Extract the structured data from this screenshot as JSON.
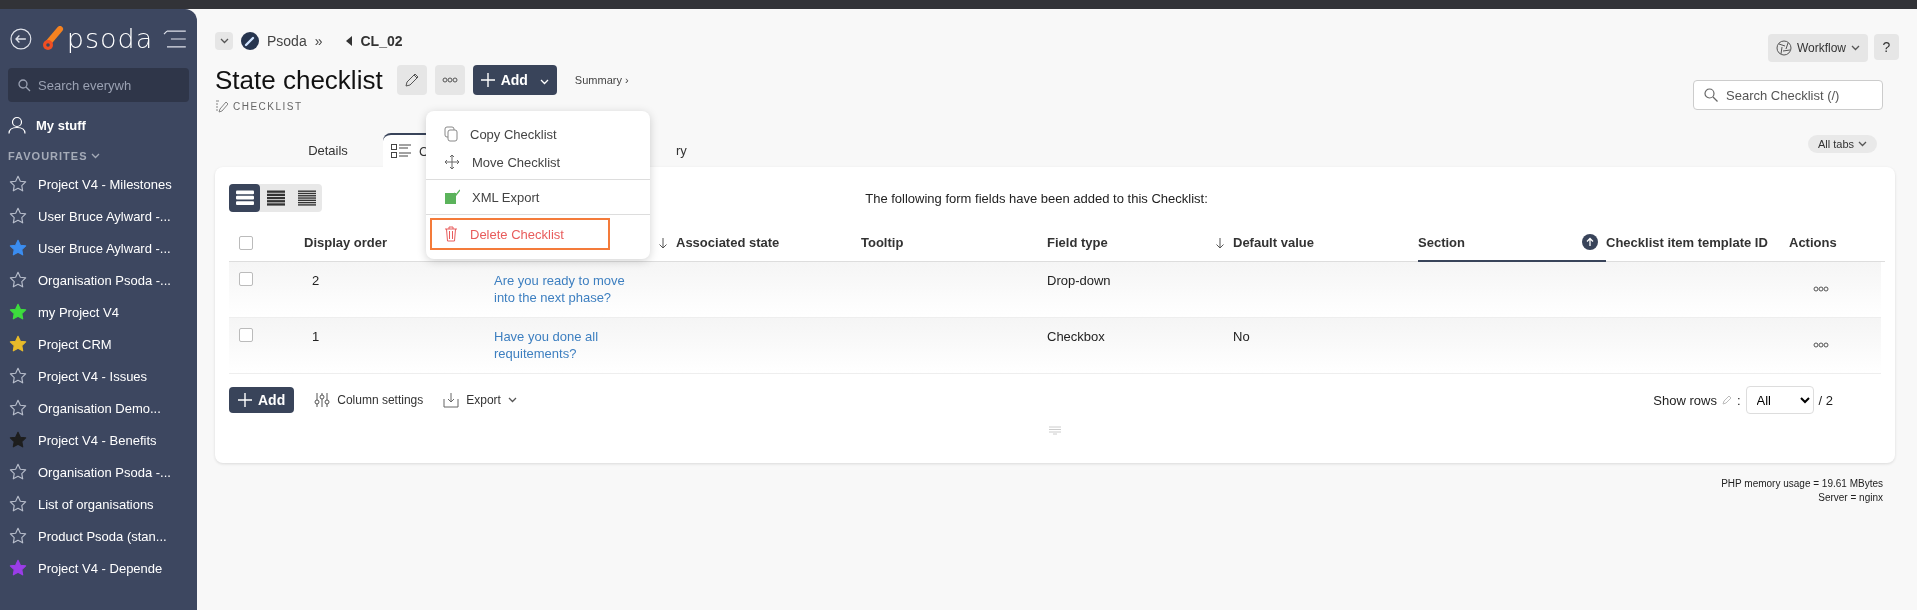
{
  "sidebar": {
    "logo": "psoda",
    "search": {
      "placeholder": "Search everywh"
    },
    "my_stuff": "My stuff",
    "favourites_heading": "FAVOURITES",
    "favourites": [
      {
        "label": "Project V4 - Milestones"
      },
      {
        "label": "User Bruce Aylward -..."
      },
      {
        "label": "User Bruce Aylward -...",
        "color": "#3b8df0"
      },
      {
        "label": "Organisation Psoda -..."
      },
      {
        "label": "my Project V4",
        "color": "#3ddc3d"
      },
      {
        "label": "Project CRM",
        "color": "#e8bb2a"
      },
      {
        "label": "Project V4 - Issues"
      },
      {
        "label": "Organisation Demo..."
      },
      {
        "label": "Project V4 - Benefits",
        "color": "#1e1e1e"
      },
      {
        "label": "Organisation Psoda -..."
      },
      {
        "label": "List of organisations"
      },
      {
        "label": "Product Psoda (stan..."
      },
      {
        "label": "Project V4 - Depende",
        "color": "#9b3de8"
      }
    ]
  },
  "breadcrumb": {
    "root": "Psoda",
    "separator": "»",
    "current": "CL_02"
  },
  "header": {
    "title": "State checklist",
    "add_button": "Add",
    "summary_link": "Summary ›",
    "type_label": "CHECKLIST",
    "workflow_button": "Workflow",
    "help_button": "?",
    "search": {
      "placeholder": "Search Checklist (/)"
    }
  },
  "tabs": [
    {
      "label": "Details",
      "selected": false
    },
    {
      "label": "C",
      "selected": true
    },
    {
      "label": "ry",
      "selected": false
    }
  ],
  "all_tabs_button": "All tabs",
  "menu": {
    "groups": [
      [
        {
          "label": "Copy Checklist",
          "kind": "copy",
          "highlighted": false
        },
        {
          "label": "Move Checklist",
          "kind": "move",
          "highlighted": false
        }
      ],
      [
        {
          "label": "XML Export",
          "kind": "xml",
          "highlighted": false
        }
      ],
      [
        {
          "label": "Delete Checklist",
          "kind": "delete",
          "highlighted": true
        }
      ]
    ]
  },
  "view_modes": [
    {
      "kind": "large",
      "selected": true
    },
    {
      "kind": "medium",
      "selected": false
    },
    {
      "kind": "small",
      "selected": false
    }
  ],
  "intro": "The following form fields have been added to this Checklist:",
  "table": {
    "select_all_checked": false,
    "columns": [
      {
        "label": "Display order",
        "kind": "plain"
      },
      {
        "kind": "sort_down"
      },
      {
        "label": "Associated state",
        "kind": "plain"
      },
      {
        "label": "Tooltip",
        "kind": "plain"
      },
      {
        "label": "Field type",
        "kind": "sort_down"
      },
      {
        "label": "Default value",
        "kind": "plain"
      },
      {
        "label": "Section",
        "kind": "sorted_up"
      },
      {
        "label": "Checklist item template ID",
        "kind": "plain"
      },
      {
        "label": "Actions",
        "kind": "plain"
      }
    ],
    "rows": [
      {
        "checked": false,
        "cells": [
          "2",
          "Are you ready to move into the next phase?",
          "",
          "",
          "Drop-down",
          "",
          "",
          "",
          ""
        ]
      },
      {
        "checked": false,
        "cells": [
          "1",
          "Have you done all requitements?",
          "",
          "",
          "Checkbox",
          "No",
          "",
          "",
          ""
        ]
      }
    ]
  },
  "footer": {
    "add_button": "Add",
    "column_settings": "Column settings",
    "export": "Export",
    "show_rows_label": "Show rows",
    "show_rows_colon": ":",
    "show_rows_value": "All",
    "total": "/ 2"
  },
  "status": [
    "PHP memory usage = 19.61 MBytes",
    "Server = nginx"
  ]
}
